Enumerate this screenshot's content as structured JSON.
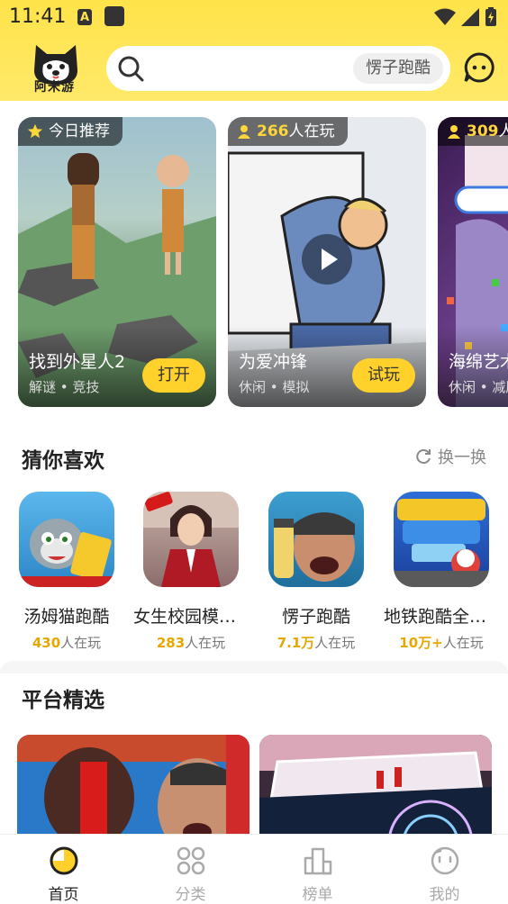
{
  "status": {
    "time": "11:41",
    "a_badge": "A"
  },
  "header": {
    "logo_text": "阿米游",
    "search_hint": "愣子跑酷"
  },
  "featured": [
    {
      "tag": "今日推荐",
      "tag_number": "",
      "title": "找到外星人2",
      "subtitle": "解谜 • 竞技",
      "button": "打开"
    },
    {
      "tag": "人在玩",
      "tag_number": "266",
      "title": "为爱冲锋",
      "subtitle": "休闲 • 模拟",
      "button": "试玩"
    },
    {
      "tag": "人",
      "tag_number": "309",
      "title": "海绵艺术",
      "subtitle": "休闲 • 减压",
      "button": ""
    }
  ],
  "guess": {
    "title": "猜你喜欢",
    "refresh_label": "换一换",
    "apps": [
      {
        "name": "汤姆猫跑酷",
        "count": "430",
        "suffix": "人在玩"
      },
      {
        "name": "女生校园模拟器",
        "count": "283",
        "suffix": "人在玩"
      },
      {
        "name": "愣子跑酷",
        "count": "7.1万",
        "suffix": "人在玩"
      },
      {
        "name": "地铁跑酷全明星",
        "count": "10万+",
        "suffix": "人在玩"
      }
    ]
  },
  "platform": {
    "title": "平台精选"
  },
  "nav": [
    {
      "label": "首页",
      "icon": "home-icon"
    },
    {
      "label": "分类",
      "icon": "category-icon"
    },
    {
      "label": "榜单",
      "icon": "ranking-icon"
    },
    {
      "label": "我的",
      "icon": "profile-icon"
    }
  ],
  "colors": {
    "accent": "#ffd12a",
    "header": "#ffe34a",
    "count": "#e7a700"
  }
}
